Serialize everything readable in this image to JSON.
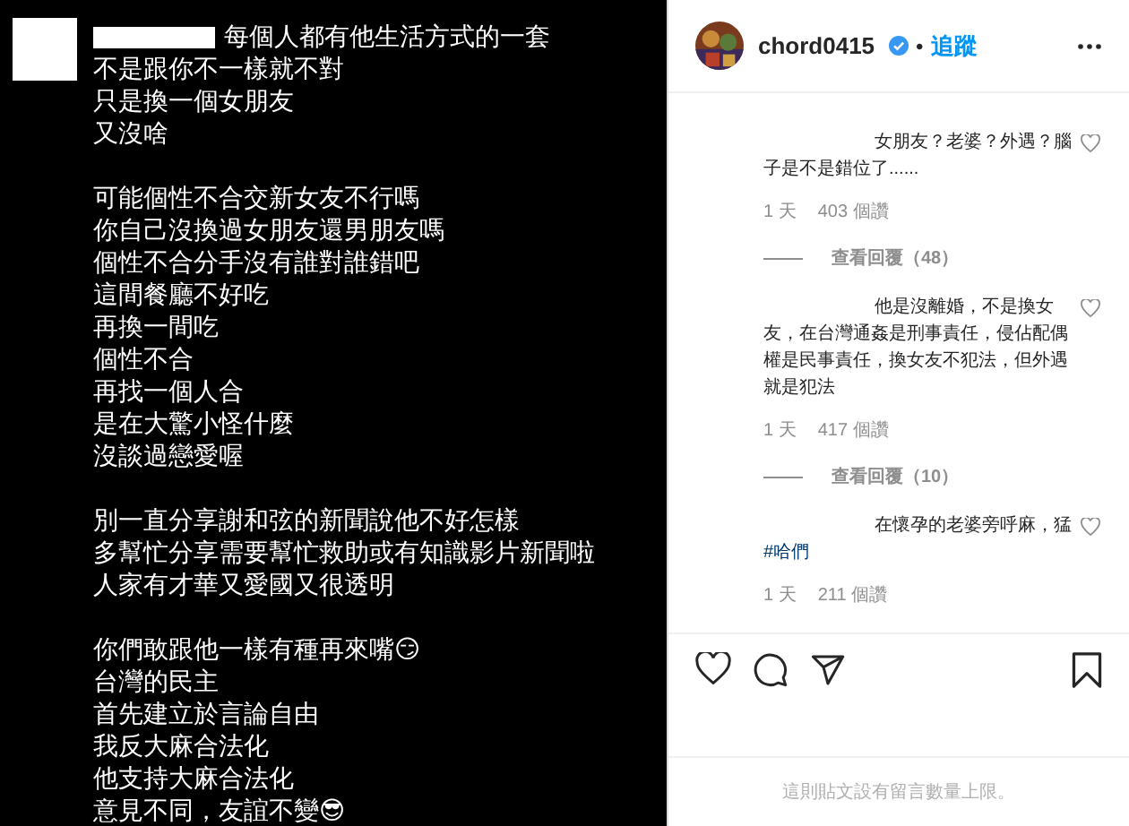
{
  "story": {
    "first_line": "每個人都有他生活方式的一套",
    "paragraphs": [
      [
        "不是跟你不一樣就不對",
        "只是換一個女朋友",
        "又沒啥"
      ],
      [
        "可能個性不合交新女友不行嗎",
        "你自己沒換過女朋友還男朋友嗎",
        "個性不合分手沒有誰對誰錯吧",
        "這間餐廳不好吃",
        "再換一間吃",
        "個性不合",
        "再找一個人合",
        "是在大驚小怪什麼",
        "沒談過戀愛喔"
      ],
      [
        "別一直分享謝和弦的新聞說他不好怎樣",
        "多幫忙分享需要幫忙救助或有知識影片新聞啦",
        "人家有才華又愛國又很透明"
      ],
      [
        "你們敢跟他一樣有種再來嘴😏",
        "台灣的民主",
        "首先建立於言論自由",
        "我反大麻合法化",
        "他支持大麻合法化",
        "意見不同，友誼不變😎"
      ]
    ]
  },
  "header": {
    "username": "chord0415",
    "verified": true,
    "separator": "•",
    "follow": "追蹤"
  },
  "comments": [
    {
      "text": "女朋友？老婆？外遇？腦子是不是錯位了......",
      "time": "1 天",
      "likes": "403 個讚",
      "replies": "查看回覆（48）"
    },
    {
      "text": "他是沒離婚，不是換女友，在台灣通姦是刑事責任，侵佔配偶權是民事責任，換女友不犯法，但外遇就是犯法",
      "time": "1 天",
      "likes": "417 個讚",
      "replies": "查看回覆（10）"
    },
    {
      "text": "在懷孕的老婆旁呼麻，猛",
      "hashtag": "#哈們",
      "time": "1 天",
      "likes": "211 個讚"
    }
  ],
  "footer": "這則貼文設有留言數量上限。"
}
